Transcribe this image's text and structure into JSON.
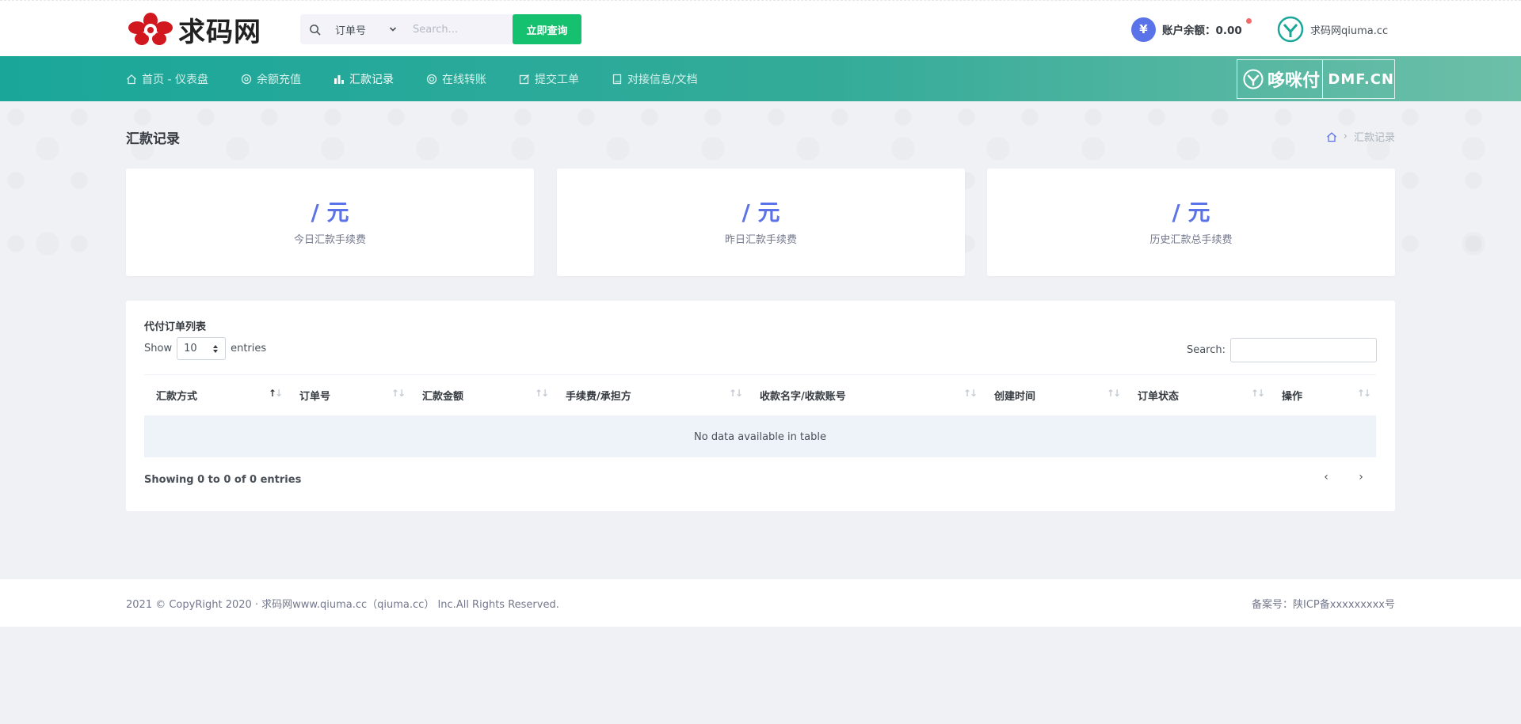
{
  "header": {
    "logo_text": "求码网",
    "search_type": "订单号",
    "search_placeholder": "Search...",
    "search_button": "立即查询",
    "balance_label": "账户余额：0.00",
    "currency_symbol": "¥",
    "user_name": "求码网qiuma.cc"
  },
  "nav": {
    "items": [
      {
        "label": "首页 - 仪表盘",
        "icon": "home-icon",
        "active": false
      },
      {
        "label": "余额充值",
        "icon": "target-icon",
        "active": false
      },
      {
        "label": "汇款记录",
        "icon": "bar-chart-icon",
        "active": true
      },
      {
        "label": "在线转账",
        "icon": "lifebuoy-icon",
        "active": false
      },
      {
        "label": "提交工单",
        "icon": "edit-icon",
        "active": false
      },
      {
        "label": "对接信息/文档",
        "icon": "book-icon",
        "active": false
      }
    ],
    "promo_name": "哆咪付",
    "promo_domain": "DMF.CN"
  },
  "page": {
    "title": "汇款记录",
    "breadcrumb_current": "汇款记录"
  },
  "stats": [
    {
      "value": "/ 元",
      "label": "今日汇款手续费"
    },
    {
      "value": "/ 元",
      "label": "昨日汇款手续费"
    },
    {
      "value": "/ 元",
      "label": "历史汇款总手续费"
    }
  ],
  "table": {
    "title": "代付订单列表",
    "show_label": "Show",
    "entries_label": "entries",
    "page_length": "10",
    "search_label": "Search:",
    "columns": [
      "汇款方式",
      "订单号",
      "汇款金额",
      "手续费/承担方",
      "收款名字/收款账号",
      "创建时间",
      "订单状态",
      "操作"
    ],
    "empty_message": "No data available in table",
    "info": "Showing 0 to 0 of 0 entries",
    "prev": "‹",
    "next": "›"
  },
  "footer": {
    "left": "2021 © CopyRight 2020 · 求码网www.qiuma.cc（qiuma.cc） Inc.All Rights Reserved.",
    "right": "备案号：陕ICP备xxxxxxxxx号"
  },
  "colors": {
    "accent": "#5b73e8",
    "nav_bg": "#1aa79a",
    "search_button_bg": "#15c06e"
  }
}
